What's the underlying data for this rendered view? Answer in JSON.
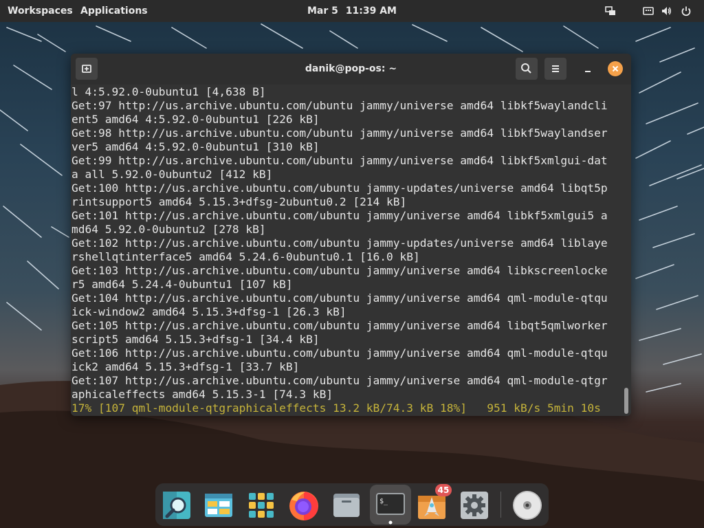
{
  "topbar": {
    "workspaces": "Workspaces",
    "applications": "Applications",
    "date": "Mar 5",
    "time": "11:39 AM"
  },
  "window": {
    "title": "danik@pop-os: ~"
  },
  "terminal": {
    "lines": [
      "l 4:5.92.0-0ubuntu1 [4,638 B]",
      "Get:97 http://us.archive.ubuntu.com/ubuntu jammy/universe amd64 libkf5waylandcli",
      "ent5 amd64 4:5.92.0-0ubuntu1 [226 kB]",
      "Get:98 http://us.archive.ubuntu.com/ubuntu jammy/universe amd64 libkf5waylandser",
      "ver5 amd64 4:5.92.0-0ubuntu1 [310 kB]",
      "Get:99 http://us.archive.ubuntu.com/ubuntu jammy/universe amd64 libkf5xmlgui-dat",
      "a all 5.92.0-0ubuntu2 [412 kB]",
      "Get:100 http://us.archive.ubuntu.com/ubuntu jammy-updates/universe amd64 libqt5p",
      "rintsupport5 amd64 5.15.3+dfsg-2ubuntu0.2 [214 kB]",
      "Get:101 http://us.archive.ubuntu.com/ubuntu jammy/universe amd64 libkf5xmlgui5 a",
      "md64 5.92.0-0ubuntu2 [278 kB]",
      "Get:102 http://us.archive.ubuntu.com/ubuntu jammy-updates/universe amd64 liblaye",
      "rshellqtinterface5 amd64 5.24.6-0ubuntu0.1 [16.0 kB]",
      "Get:103 http://us.archive.ubuntu.com/ubuntu jammy/universe amd64 libkscreenlocke",
      "r5 amd64 5.24.4-0ubuntu1 [107 kB]",
      "Get:104 http://us.archive.ubuntu.com/ubuntu jammy/universe amd64 qml-module-qtqu",
      "ick-window2 amd64 5.15.3+dfsg-1 [26.3 kB]",
      "Get:105 http://us.archive.ubuntu.com/ubuntu jammy/universe amd64 libqt5qmlworker",
      "script5 amd64 5.15.3+dfsg-1 [34.4 kB]",
      "Get:106 http://us.archive.ubuntu.com/ubuntu jammy/universe amd64 qml-module-qtqu",
      "ick2 amd64 5.15.3+dfsg-1 [33.7 kB]",
      "Get:107 http://us.archive.ubuntu.com/ubuntu jammy/universe amd64 qml-module-qtgr",
      "aphicaleffects amd64 5.15.3-1 [74.3 kB]"
    ],
    "progress": "17% [107 qml-module-qtgraphicaleffects 13.2 kB/74.3 kB 18%]   951 kB/s 5min 10s"
  },
  "dock": {
    "items": [
      {
        "icon": "search-magnifier-icon"
      },
      {
        "icon": "gnome-software-icon"
      },
      {
        "icon": "app-grid-icon"
      },
      {
        "icon": "firefox-icon"
      },
      {
        "icon": "files-icon"
      },
      {
        "icon": "terminal-icon"
      },
      {
        "icon": "pop-shop-icon"
      },
      {
        "icon": "settings-gear-icon"
      },
      {
        "icon": "optical-disc-icon"
      }
    ],
    "shop_badge": "45"
  },
  "colors": {
    "topbar_bg": "#2b2b2b",
    "terminal_bg": "#333333",
    "terminal_text": "#e6e6e6",
    "progress_text": "#c6b43a",
    "close_button": "#f5a14a",
    "badge": "#e05656"
  }
}
